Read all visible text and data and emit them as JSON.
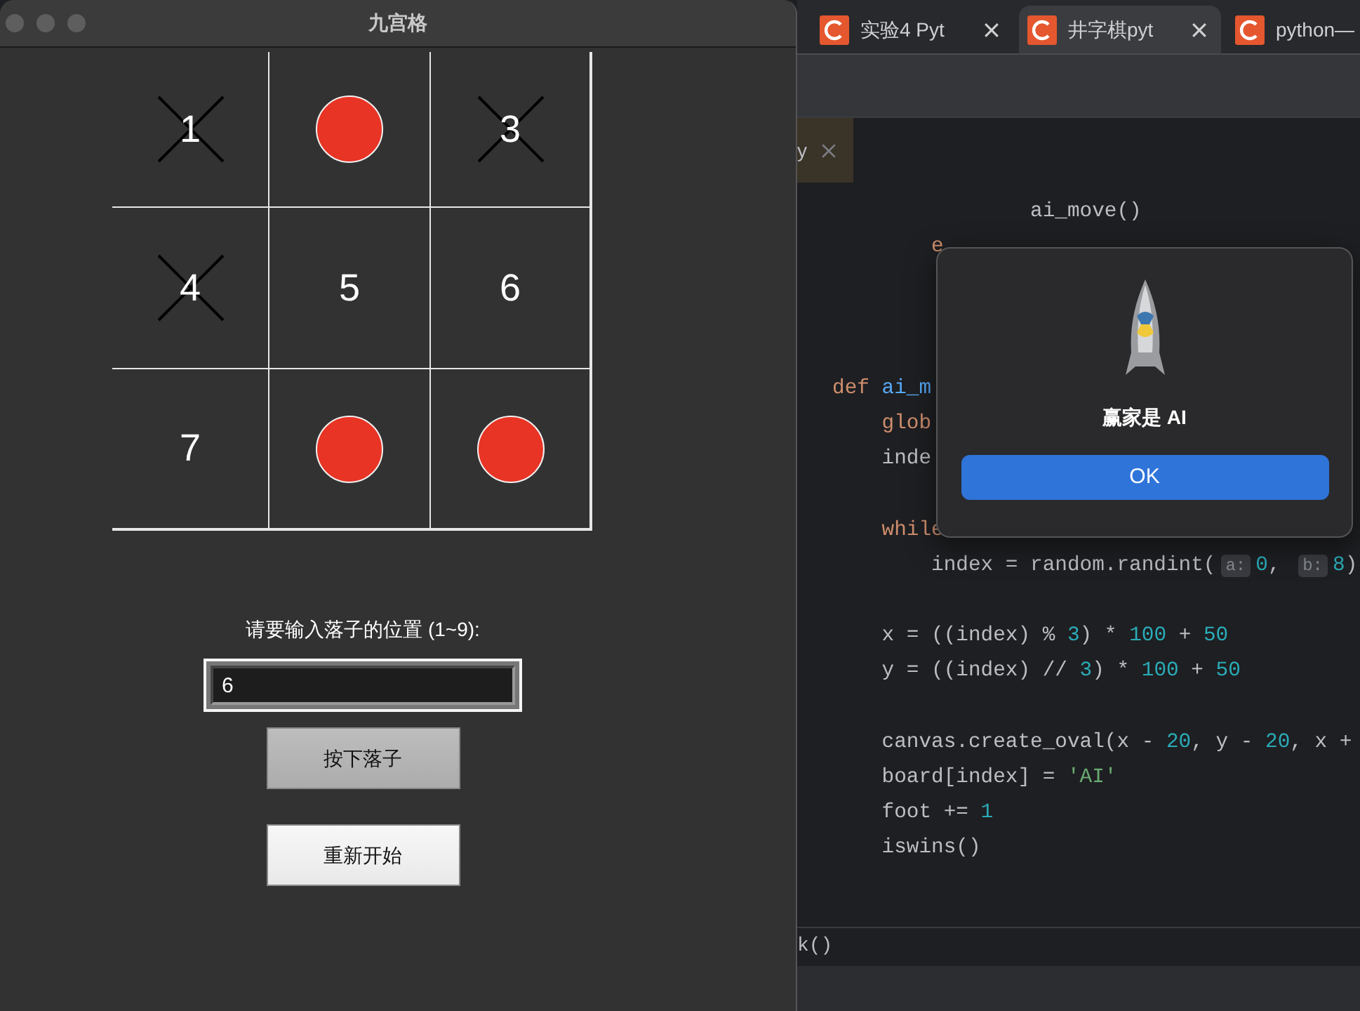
{
  "game_window": {
    "title": "九宫格",
    "board": [
      {
        "kind": "x",
        "number": "1"
      },
      {
        "kind": "o"
      },
      {
        "kind": "x",
        "number": "3"
      },
      {
        "kind": "x",
        "number": "4"
      },
      {
        "kind": "empty",
        "number": "5"
      },
      {
        "kind": "empty",
        "number": "6"
      },
      {
        "kind": "empty",
        "number": "7"
      },
      {
        "kind": "o"
      },
      {
        "kind": "o"
      }
    ],
    "prompt": "请要输入落子的位置 (1~9):",
    "position_input": {
      "value": "6"
    },
    "buttons": [
      {
        "label": "按下落子",
        "kind": "pressed"
      },
      {
        "label": "重新开始",
        "kind": "normal"
      }
    ]
  },
  "browser_tabs": [
    {
      "label": "实验4 Pyt",
      "selected": false
    },
    {
      "label": "井字棋pyt",
      "selected": true
    },
    {
      "label": "python—",
      "selected": false
    }
  ],
  "editor": {
    "file_tab": "y",
    "lines": [
      {
        "kind": "code",
        "tokens": [
          {
            "text": "                ai_move()",
            "kind": "plain"
          }
        ]
      },
      {
        "kind": "code",
        "tokens": [
          {
            "text": "        e",
            "kind": "keyword"
          }
        ]
      },
      {
        "kind": "blank"
      },
      {
        "kind": "blank"
      },
      {
        "kind": "blank"
      },
      {
        "kind": "code",
        "tokens": [
          {
            "text": "def ",
            "kind": "keyword"
          },
          {
            "text": "ai_m",
            "kind": "func"
          }
        ]
      },
      {
        "kind": "code",
        "tokens": [
          {
            "text": "    glob",
            "kind": "keyword"
          }
        ]
      },
      {
        "kind": "code",
        "tokens": [
          {
            "text": "    inde",
            "kind": "plain"
          }
        ]
      },
      {
        "kind": "blank"
      },
      {
        "kind": "code",
        "tokens": [
          {
            "text": "    while",
            "kind": "keyword"
          }
        ]
      },
      {
        "kind": "code",
        "tokens": [
          {
            "text": "        index = random.randint(",
            "kind": "plain"
          },
          {
            "text": "a:",
            "kind": "hint"
          },
          {
            "text": "0",
            "kind": "number"
          },
          {
            "text": ", ",
            "kind": "plain"
          },
          {
            "text": "b:",
            "kind": "hint"
          },
          {
            "text": "8",
            "kind": "number"
          },
          {
            "text": ")",
            "kind": "plain"
          }
        ]
      },
      {
        "kind": "blank"
      },
      {
        "kind": "code",
        "tokens": [
          {
            "text": "    x = ((index) % ",
            "kind": "plain"
          },
          {
            "text": "3",
            "kind": "number"
          },
          {
            "text": ") * ",
            "kind": "plain"
          },
          {
            "text": "100",
            "kind": "number"
          },
          {
            "text": " + ",
            "kind": "plain"
          },
          {
            "text": "50",
            "kind": "number"
          }
        ]
      },
      {
        "kind": "code",
        "tokens": [
          {
            "text": "    y = ((index) // ",
            "kind": "plain"
          },
          {
            "text": "3",
            "kind": "number"
          },
          {
            "text": ") * ",
            "kind": "plain"
          },
          {
            "text": "100",
            "kind": "number"
          },
          {
            "text": " + ",
            "kind": "plain"
          },
          {
            "text": "50",
            "kind": "number"
          }
        ]
      },
      {
        "kind": "blank"
      },
      {
        "kind": "code",
        "tokens": [
          {
            "text": "    canvas.create_oval(x - ",
            "kind": "plain"
          },
          {
            "text": "20",
            "kind": "number"
          },
          {
            "text": ", y - ",
            "kind": "plain"
          },
          {
            "text": "20",
            "kind": "number"
          },
          {
            "text": ", x +",
            "kind": "plain"
          }
        ]
      },
      {
        "kind": "code",
        "tokens": [
          {
            "text": "    board[index] = ",
            "kind": "plain"
          },
          {
            "text": "'AI'",
            "kind": "string"
          }
        ]
      },
      {
        "kind": "code",
        "tokens": [
          {
            "text": "    foot += ",
            "kind": "plain"
          },
          {
            "text": "1",
            "kind": "number"
          }
        ]
      },
      {
        "kind": "code",
        "tokens": [
          {
            "text": "    iswins()",
            "kind": "plain"
          }
        ]
      }
    ],
    "breadcrumb": "k()"
  },
  "dialog": {
    "message": "赢家是 AI",
    "button": "OK"
  }
}
